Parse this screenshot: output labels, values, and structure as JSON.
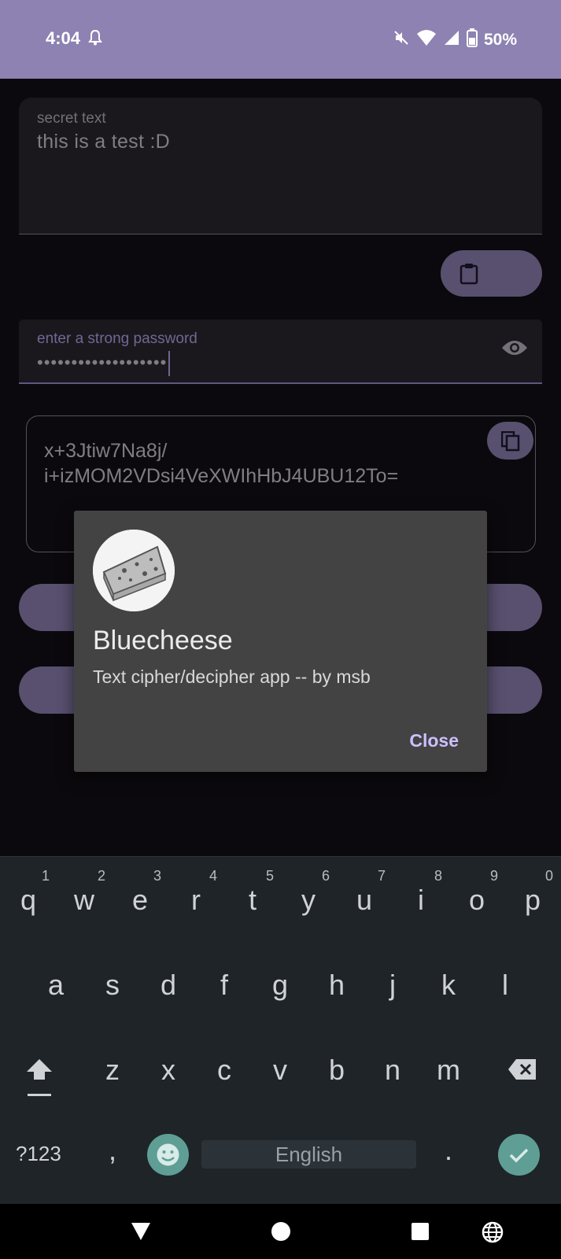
{
  "status_bar": {
    "time": "4:04",
    "battery": "50%",
    "icons": [
      "bell-icon",
      "mute-icon",
      "wifi-icon",
      "signal-icon",
      "battery-icon"
    ]
  },
  "secret_field": {
    "label": "secret text",
    "value": "this is a test :D"
  },
  "paste_button": {
    "icon": "clipboard-icon"
  },
  "password_field": {
    "label": "enter a strong password",
    "masked_value": "•••••••••••••••••••",
    "toggle_icon": "eye-icon"
  },
  "output": {
    "text": "x+3Jtiw7Na8j/\ni+izMOM2VDsi4VeXWIhHbJ4UBU12To=",
    "copy_icon": "copy-icon"
  },
  "dialog": {
    "title": "Bluecheese",
    "subtitle": "Text cipher/decipher app -- by msb",
    "close_label": "Close",
    "avatar": "cheese-logo"
  },
  "keyboard": {
    "row1": [
      "q",
      "w",
      "e",
      "r",
      "t",
      "y",
      "u",
      "i",
      "o",
      "p"
    ],
    "row1_hints": [
      "1",
      "2",
      "3",
      "4",
      "5",
      "6",
      "7",
      "8",
      "9",
      "0"
    ],
    "row2": [
      "a",
      "s",
      "d",
      "f",
      "g",
      "h",
      "j",
      "k",
      "l"
    ],
    "row3": [
      "z",
      "x",
      "c",
      "v",
      "b",
      "n",
      "m"
    ],
    "symbols_label": "?123",
    "comma": ",",
    "period": ".",
    "space_label": "English"
  },
  "colors": {
    "accent": "#8e82b2",
    "dialog_bg": "#434343",
    "keyboard_bg": "#1f2428",
    "keyboard_accent": "#5f9e95"
  }
}
